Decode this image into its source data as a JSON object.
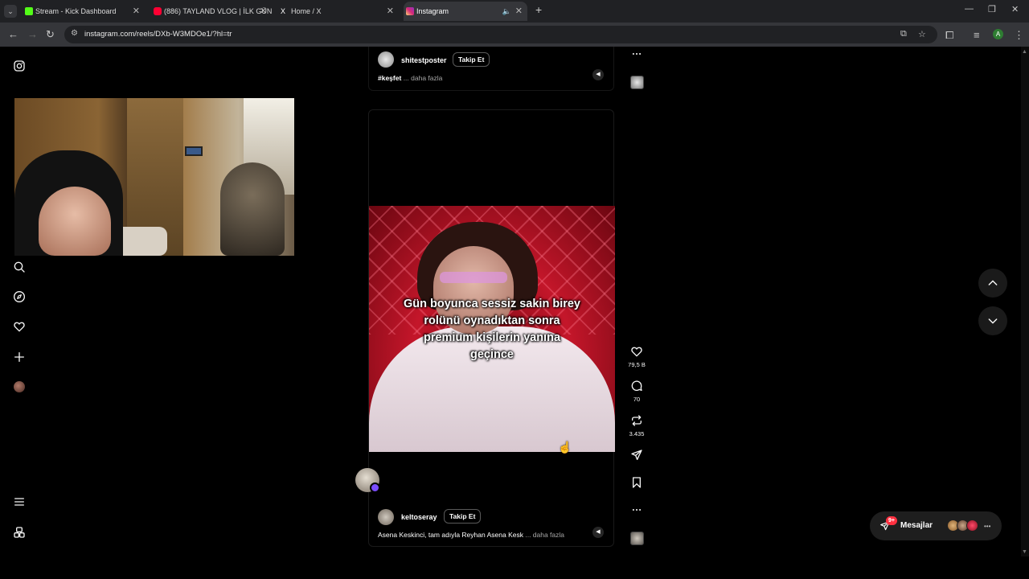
{
  "browser": {
    "tabs": [
      {
        "title": "Stream - Kick Dashboard",
        "favicon_color": "#53fc18",
        "favicon": "kick-icon"
      },
      {
        "title": "(886) TAYLAND VLOG | İLK GÜN",
        "favicon_color": "#ff0033",
        "favicon": "youtube-icon"
      },
      {
        "title": "Home / X",
        "favicon_color": "#ffffff",
        "favicon": "x-icon"
      },
      {
        "title": "Instagram",
        "favicon_color": "#e1306c",
        "favicon": "instagram-icon",
        "active": true
      }
    ],
    "url": "instagram.com/reels/DXb-W3MDOe1/?hl=tr",
    "profile_initial": "A"
  },
  "reels": {
    "previous": {
      "username": "shitestposter",
      "follow_label": "Takip Et",
      "caption": "#keşfet",
      "more_label": "... daha fazla"
    },
    "current": {
      "overlay_text_lines": [
        "Gün boyunca sessiz sakin birey",
        "rolünü oynadıktan sonra",
        "premium kişilerin yanına",
        "geçince"
      ],
      "username": "keltoseray",
      "follow_label": "Takip Et",
      "caption": "Asena Keskinci, tam adıyla Reyhan Asena Kesk",
      "more_label": "... daha fazla",
      "likes": "79,5 B",
      "comments": "70",
      "reposts": "3.435"
    }
  },
  "messages": {
    "label": "Mesajlar",
    "badge": "9+"
  },
  "colors": {
    "accent_badge": "#ff3040",
    "background": "#000000"
  }
}
